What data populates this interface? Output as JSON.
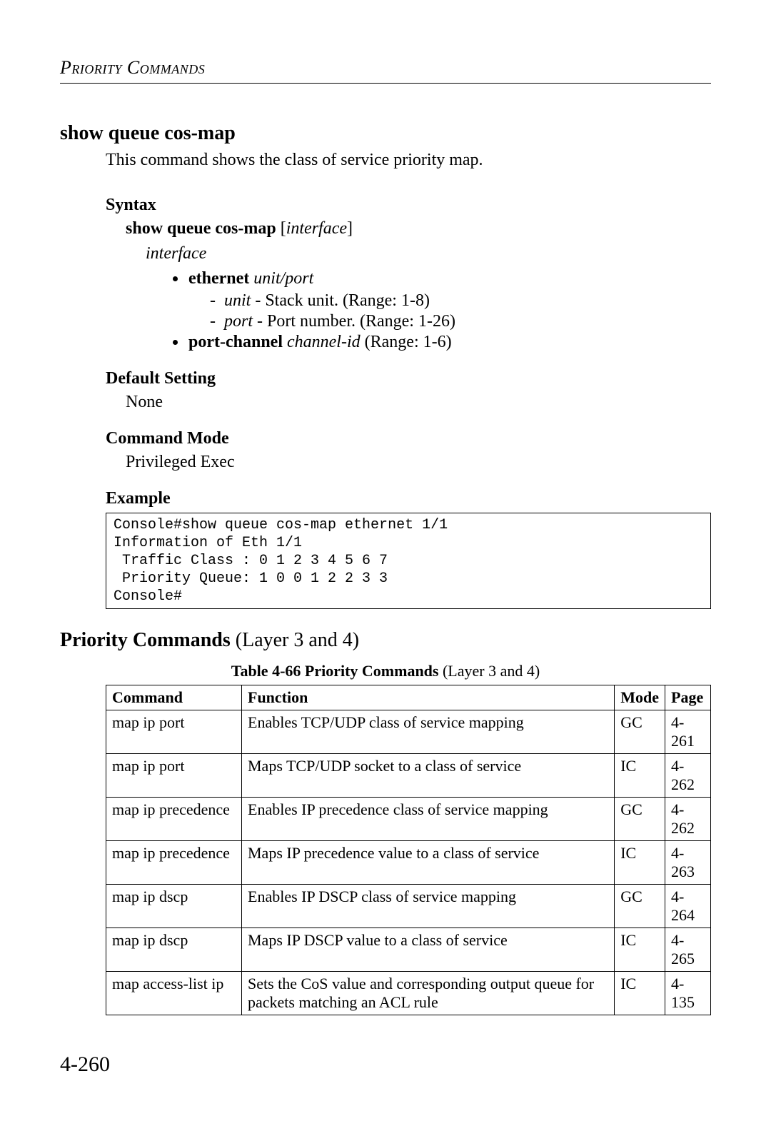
{
  "header": {
    "running_title": "Priority Commands"
  },
  "command": {
    "title": "show queue cos-map",
    "description": "This command shows the class of service priority map.",
    "syntax": {
      "label": "Syntax",
      "line_bold": "show queue cos-map",
      "line_opt_open": " [",
      "line_opt_arg": "interface",
      "line_opt_close": "]",
      "interface_label": "interface",
      "ethernet": {
        "kw": "ethernet",
        "args": "unit/port",
        "unit_label": "unit",
        "unit_desc": " - Stack unit. (Range: 1-8)",
        "port_label": "port",
        "port_desc": " - Port number. (Range: 1-26)"
      },
      "port_channel": {
        "kw": "port-channel",
        "arg": "channel-id",
        "range": " (Range: 1-6)"
      }
    },
    "default_setting": {
      "label": "Default Setting",
      "value": "None"
    },
    "command_mode": {
      "label": "Command Mode",
      "value": "Privileged Exec"
    },
    "example": {
      "label": "Example",
      "code": "Console#show queue cos-map ethernet 1/1\nInformation of Eth 1/1\n Traffic Class : 0 1 2 3 4 5 6 7\n Priority Queue: 1 0 0 1 2 2 3 3\nConsole#"
    }
  },
  "section": {
    "title_bold": "Priority Commands",
    "title_light": " (Layer 3 and 4)",
    "table_caption_bold": "Table 4-66   Priority Commands",
    "table_caption_light": " (Layer 3 and 4)",
    "table": {
      "headers": {
        "c0": "Command",
        "c1": "Function",
        "c2": "Mode",
        "c3": "Page"
      },
      "rows": [
        {
          "c0": "map ip port",
          "c1": "Enables TCP/UDP class of service mapping",
          "c2": "GC",
          "c3": "4-261"
        },
        {
          "c0": "map ip port",
          "c1": "Maps TCP/UDP socket to a class of service",
          "c2": "IC",
          "c3": "4-262"
        },
        {
          "c0": "map ip precedence",
          "c1": "Enables IP precedence class of service mapping",
          "c2": "GC",
          "c3": "4-262"
        },
        {
          "c0": "map ip precedence",
          "c1": "Maps IP precedence value to a class of service",
          "c2": "IC",
          "c3": "4-263"
        },
        {
          "c0": "map ip dscp",
          "c1": "Enables IP DSCP class of service mapping",
          "c2": "GC",
          "c3": "4-264"
        },
        {
          "c0": "map ip dscp",
          "c1": "Maps IP DSCP value to a class of service",
          "c2": "IC",
          "c3": "4-265"
        },
        {
          "c0": "map access-list ip",
          "c1": "Sets the CoS value and corresponding output queue for packets matching an ACL rule",
          "c2": "IC",
          "c3": "4-135"
        }
      ]
    }
  },
  "page_number": "4-260"
}
